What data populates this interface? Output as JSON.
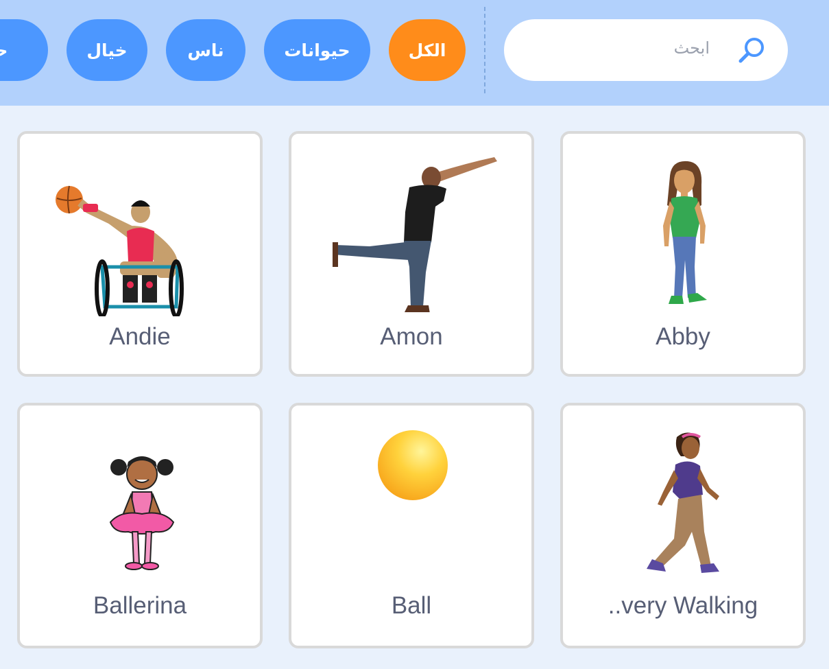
{
  "search": {
    "placeholder": "ابحث",
    "value": ""
  },
  "categories": [
    {
      "label": "الكل",
      "active": true
    },
    {
      "label": "حيوانات",
      "active": false
    },
    {
      "label": "ناس",
      "active": false
    },
    {
      "label": "خيال",
      "active": false
    },
    {
      "label": "حفلة",
      "active": false
    }
  ],
  "sprites": [
    {
      "name": "Abby",
      "icon": "girl-green-shirt-sprite"
    },
    {
      "name": "Amon",
      "icon": "man-balancing-sprite"
    },
    {
      "name": "Andie",
      "icon": "wheelchair-basketball-sprite"
    },
    {
      "name": "..very Walking",
      "icon": "woman-walking-sprite"
    },
    {
      "name": "Ball",
      "icon": "yellow-ball-sprite"
    },
    {
      "name": "Ballerina",
      "icon": "ballerina-sprite"
    }
  ],
  "colors": {
    "active_tag": "#ff8c1a",
    "tag": "#4c97ff",
    "topbar": "#b2d1fc",
    "background": "#e9f1fc"
  }
}
